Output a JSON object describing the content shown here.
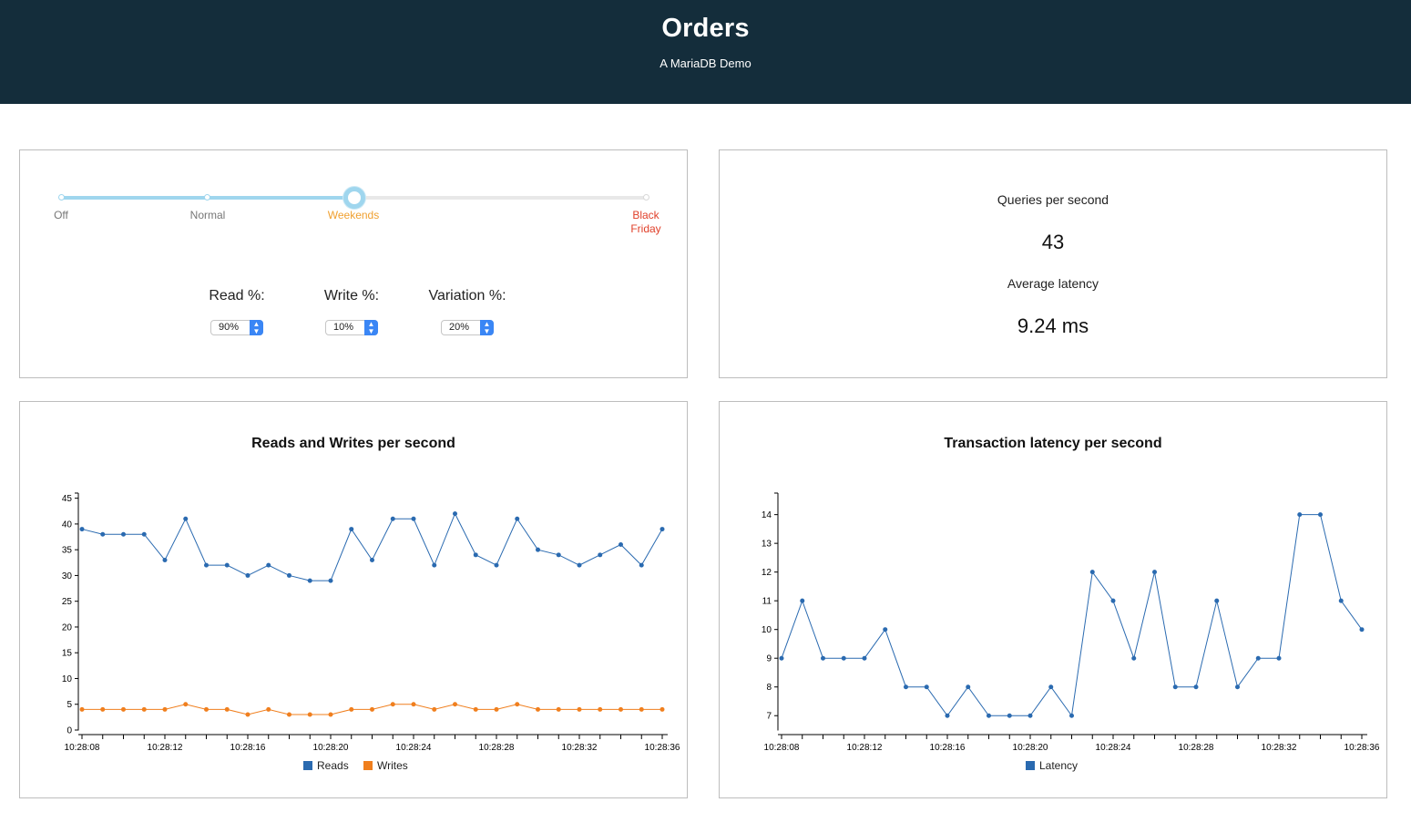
{
  "header": {
    "title": "Orders",
    "subtitle": "A MariaDB Demo"
  },
  "slider": {
    "levels": [
      "Off",
      "Normal",
      "Weekends",
      "Black Friday"
    ],
    "selected": "Weekends",
    "selected_index": 2
  },
  "controls": {
    "read": {
      "label": "Read %:",
      "value": "90%"
    },
    "write": {
      "label": "Write %:",
      "value": "10%"
    },
    "variation": {
      "label": "Variation %:",
      "value": "20%"
    }
  },
  "stats": {
    "qps_label": "Queries per second",
    "qps_value": "43",
    "latency_label": "Average latency",
    "latency_value": "9.24 ms"
  },
  "colors": {
    "reads": "#2a6ab0",
    "writes": "#f07f1e",
    "latency": "#2a6ab0",
    "header_bg": "#142d3b"
  },
  "chart_data": [
    {
      "type": "line",
      "title": "Reads and Writes per second",
      "x": [
        "10:28:08",
        "10:28:09",
        "10:28:10",
        "10:28:11",
        "10:28:12",
        "10:28:13",
        "10:28:14",
        "10:28:15",
        "10:28:16",
        "10:28:17",
        "10:28:18",
        "10:28:19",
        "10:28:20",
        "10:28:21",
        "10:28:22",
        "10:28:23",
        "10:28:24",
        "10:28:25",
        "10:28:26",
        "10:28:27",
        "10:28:28",
        "10:28:29",
        "10:28:30",
        "10:28:31",
        "10:28:32",
        "10:28:33",
        "10:28:34",
        "10:28:35",
        "10:28:36"
      ],
      "x_ticks": [
        "10:28:08",
        "10:28:12",
        "10:28:16",
        "10:28:20",
        "10:28:24",
        "10:28:28",
        "10:28:32",
        "10:28:36"
      ],
      "series": [
        {
          "name": "Reads",
          "values": [
            39,
            38,
            38,
            38,
            33,
            41,
            32,
            32,
            30,
            32,
            30,
            29,
            29,
            39,
            33,
            41,
            41,
            32,
            42,
            34,
            32,
            41,
            35,
            34,
            32,
            34,
            36,
            32,
            39
          ]
        },
        {
          "name": "Writes",
          "values": [
            4,
            4,
            4,
            4,
            4,
            5,
            4,
            4,
            3,
            4,
            3,
            3,
            3,
            4,
            4,
            5,
            5,
            4,
            5,
            4,
            4,
            5,
            4,
            4,
            4,
            4,
            4,
            4,
            4
          ]
        }
      ],
      "ylim": [
        0,
        46
      ],
      "y_ticks": [
        0,
        5,
        10,
        15,
        20,
        25,
        30,
        35,
        40,
        45
      ],
      "legend": "bottom"
    },
    {
      "type": "line",
      "title": "Transaction latency per second",
      "x": [
        "10:28:08",
        "10:28:09",
        "10:28:10",
        "10:28:11",
        "10:28:12",
        "10:28:13",
        "10:28:14",
        "10:28:15",
        "10:28:16",
        "10:28:17",
        "10:28:18",
        "10:28:19",
        "10:28:20",
        "10:28:21",
        "10:28:22",
        "10:28:23",
        "10:28:24",
        "10:28:25",
        "10:28:26",
        "10:28:27",
        "10:28:28",
        "10:28:29",
        "10:28:30",
        "10:28:31",
        "10:28:32",
        "10:28:33",
        "10:28:34",
        "10:28:35",
        "10:28:36",
        "10:28:37"
      ],
      "x_ticks": [
        "10:28:08",
        "10:28:12",
        "10:28:16",
        "10:28:20",
        "10:28:24",
        "10:28:28",
        "10:28:32",
        "10:28:36"
      ],
      "series": [
        {
          "name": "Latency",
          "values": [
            9,
            11,
            9,
            9,
            9,
            10,
            8,
            8,
            7,
            8,
            7,
            7,
            7,
            8,
            7,
            12,
            11,
            9,
            12,
            8,
            8,
            11,
            8,
            9,
            9,
            14,
            14,
            11,
            10,
            null
          ]
        }
      ],
      "ylim": [
        6.5,
        14.75
      ],
      "y_ticks": [
        7,
        8,
        9,
        10,
        11,
        12,
        13,
        14
      ],
      "legend": "bottom"
    }
  ]
}
